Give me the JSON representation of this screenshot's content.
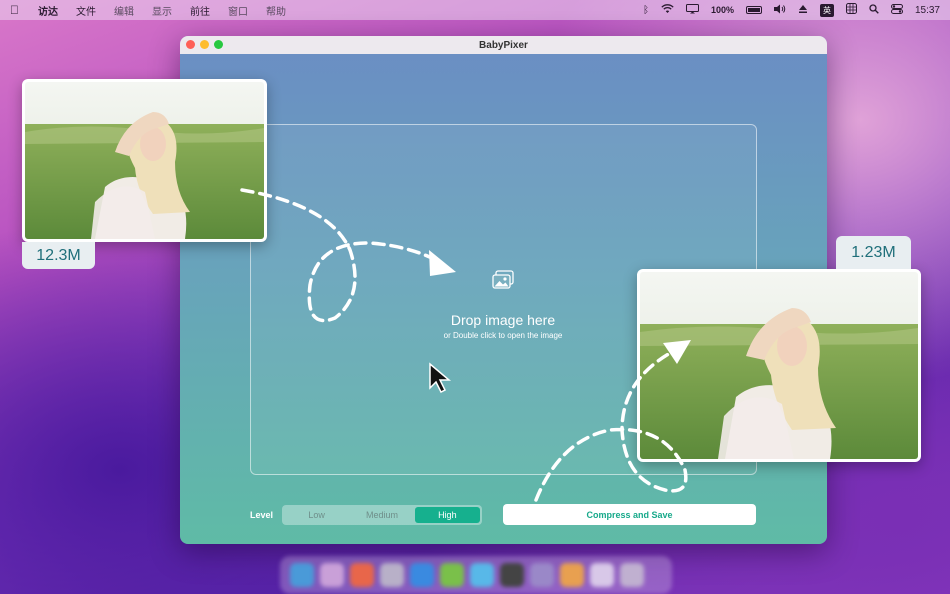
{
  "menubar": {
    "apple_icon": "apple-icon",
    "items": [
      "访达",
      "文件",
      "编辑",
      "显示",
      "前往",
      "窗口",
      "帮助"
    ],
    "battery": "100%",
    "input_method": "英",
    "clock": "15:37"
  },
  "window": {
    "title": "BabyPixer"
  },
  "dropzone": {
    "title": "Drop image here",
    "subtitle": "or Double click to open the image",
    "icon": "photos-icon"
  },
  "controls": {
    "level_label": "Level",
    "levels": [
      "Low",
      "Medium",
      "High"
    ],
    "selected_level": "High",
    "compress_label": "Compress and Save"
  },
  "showcase": {
    "original_size": "12.3M",
    "compressed_size": "1.23M"
  },
  "colors": {
    "accent": "#16b08e",
    "window_top": "#6b8dc4",
    "window_bottom": "#5fbba6"
  }
}
